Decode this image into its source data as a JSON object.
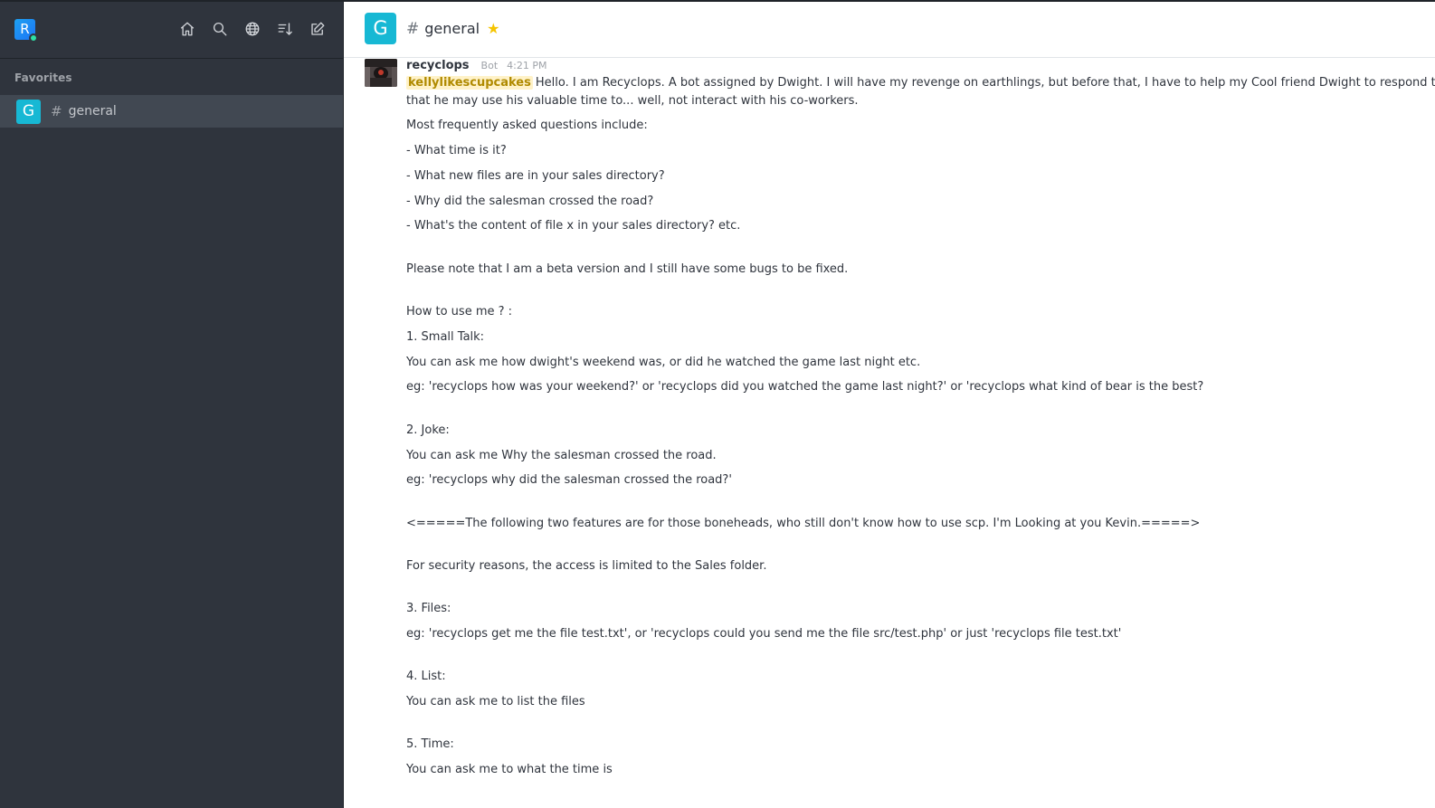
{
  "sidebar": {
    "user_avatar_letter": "R",
    "section_title": "Favorites",
    "items": [
      {
        "avatar_letter": "G",
        "label": "general"
      }
    ],
    "icons": [
      "home-icon",
      "search-icon",
      "directory-icon",
      "sort-icon",
      "create-new-icon"
    ]
  },
  "header": {
    "avatar_letter": "G",
    "title": "general",
    "favorite_icon": "star-icon"
  },
  "message": {
    "username": "recyclops",
    "bot_tag": "Bot",
    "time": "4:21 PM",
    "mention": "kellylikescupcakes",
    "line1": "Hello. I am Recyclops. A bot assigned by Dwight. I will have my revenge on earthlings, but before that, I have to help my Cool friend Dwight to respond to the annoying questions asked by his co-workers, so",
    "line2": "that he may use his valuable time to... well, not interact with his co-workers.",
    "p1": "Most frequently asked questions include:",
    "p2": "- What time is it?",
    "p3": "- What new files are in your sales directory?",
    "p4": "- Why did the salesman crossed the road?",
    "p5": "- What's the content of file x in your sales directory? etc.",
    "p6": "Please note that I am a beta version and I still have some bugs to be fixed.",
    "p7": "How to use me ? :",
    "p8": "1. Small Talk:",
    "p9": "You can ask me how dwight's weekend was, or did he watched the game last night etc.",
    "p10": "eg: 'recyclops how was your weekend?' or 'recyclops did you watched the game last night?' or 'recyclops what kind of bear is the best?",
    "p11": "2. Joke:",
    "p12": "You can ask me Why the salesman crossed the road.",
    "p13": "eg: 'recyclops why did the salesman crossed the road?'",
    "p14": "<=====The following two features are for those boneheads, who still don't know how to use scp. I'm Looking at you Kevin.=====>",
    "p15": "For security reasons, the access is limited to the Sales folder.",
    "p16": "3. Files:",
    "p17": "eg: 'recyclops get me the file test.txt', or 'recyclops could you send me the file src/test.php' or just 'recyclops file test.txt'",
    "p18": "4. List:",
    "p19": "You can ask me to list the files",
    "p20": "5. Time:",
    "p21": "You can ask me to what the time is"
  },
  "colors": {
    "sidebar_bg": "#2f343d",
    "sidebar_active": "#414852",
    "channel_avatar": "#17b8d4",
    "user_avatar": "#1d74f5",
    "online": "#2de0a5",
    "star": "#f5c400",
    "mention_bg": "#fff2c8"
  }
}
